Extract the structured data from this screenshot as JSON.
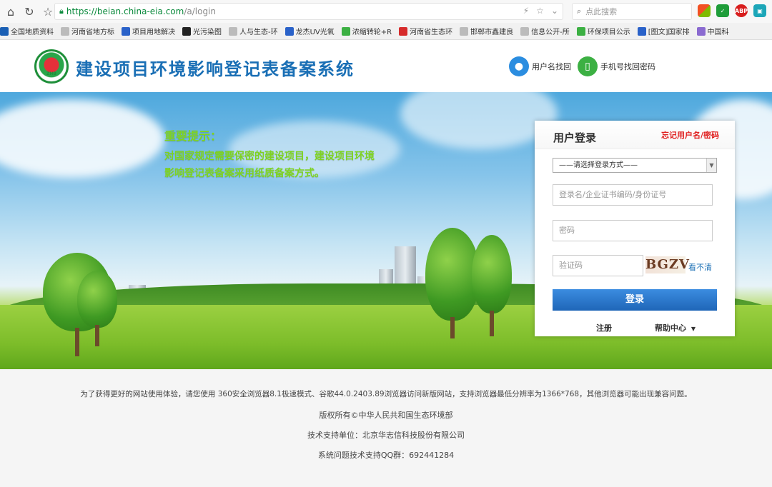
{
  "browser": {
    "url_host": "https://beian.china-eia.com",
    "url_path": "/a/login",
    "search_placeholder": "点此搜索",
    "bookmarks": [
      {
        "label": "全国地质资料",
        "color": "#1a5fb4"
      },
      {
        "label": "河南省地方标",
        "color": "#bbbbbb"
      },
      {
        "label": "项目用地解决",
        "color": "#2a62c9"
      },
      {
        "label": "光污染图",
        "color": "#222222"
      },
      {
        "label": "人与生态-环",
        "color": "#bbbbbb"
      },
      {
        "label": "龙杰UV光氧",
        "color": "#2a62c9"
      },
      {
        "label": "浓缩转轮+R",
        "color": "#3cb043"
      },
      {
        "label": "河南省生态环",
        "color": "#d62b2b"
      },
      {
        "label": "邯郸市鑫建良",
        "color": "#bbbbbb"
      },
      {
        "label": "信息公开-所",
        "color": "#bbbbbb"
      },
      {
        "label": "环保项目公示",
        "color": "#3cb043"
      },
      {
        "label": "[图文]国家排",
        "color": "#2a62c9"
      },
      {
        "label": "中国科",
        "color": "#8a6ad0"
      }
    ]
  },
  "header": {
    "logo_text": "ZHB",
    "title": "建设项目环境影响登记表备案系统",
    "username_recover": "用户名找回",
    "phone_recover": "手机号找回密码"
  },
  "banner": {
    "notice_title": "重要提示：",
    "notice_text": "对国家规定需要保密的建设项目，建设项目环境影响登记表备案采用纸质备案方式。"
  },
  "login": {
    "title": "用户登录",
    "forgot": "忘记用户名/密码",
    "method_select": "——请选择登录方式——",
    "username_placeholder": "登录名/企业证书编码/身份证号",
    "password_placeholder": "密码",
    "captcha_placeholder": "验证码",
    "captcha_text": "BGZV",
    "unclear": "看不清",
    "submit": "登录",
    "register": "注册",
    "help": "帮助中心"
  },
  "footer": {
    "line1": "为了获得更好的网站使用体验，请您使用 360安全浏览器8.1极速模式、谷歌44.0.2403.89浏览器访问新版网站，支持浏览器最低分辨率为1366*768，其他浏览器可能出现兼容问题。",
    "line2": "版权所有©中华人民共和国生态环境部",
    "line3": "技术支持单位：北京华志信科技股份有限公司",
    "line4": "系统问题技术支持QQ群：692441284"
  }
}
